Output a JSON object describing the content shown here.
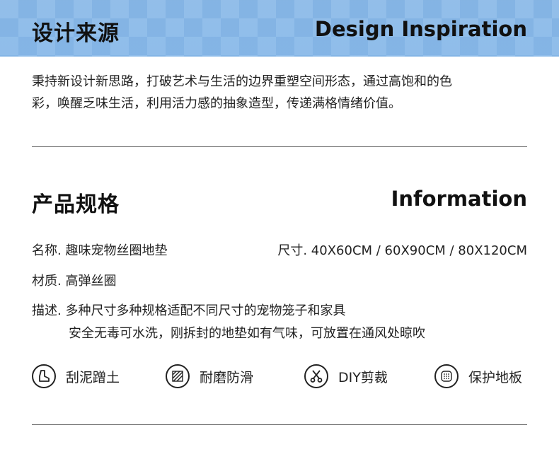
{
  "design": {
    "title_cn": "设计来源",
    "title_en": "Design Inspiration",
    "paragraph_line1": "秉持新设计新思路，打破艺术与生活的边界重塑空间形态，通过高饱和的色",
    "paragraph_line2": "彩，唤醒乏味生活，利用活力感的抽象造型，传递满格情绪价值。"
  },
  "info": {
    "title_cn": "产品规格",
    "title_en": "Information",
    "name": "名称. 趣味宠物丝圈地垫",
    "size": "尺寸. 40X60CM / 60X90CM / 80X120CM",
    "material": "材质. 高弹丝圈",
    "desc_line1": "描述. 多种尺寸多种规格适配不同尺寸的宠物笼子和家具",
    "desc_line2": "安全无毒可水洗，刚拆封的地垫如有气味，可放置在通风处晾吹"
  },
  "features": [
    {
      "icon": "shoe-icon",
      "label": "刮泥蹭土"
    },
    {
      "icon": "texture-icon",
      "label": "耐磨防滑"
    },
    {
      "icon": "scissors-icon",
      "label": "DIY剪裁"
    },
    {
      "icon": "floor-icon",
      "label": "保护地板"
    }
  ],
  "colors": {
    "header_band": "#8dbbe8",
    "text": "#1a1a1a",
    "divider": "#666666"
  }
}
